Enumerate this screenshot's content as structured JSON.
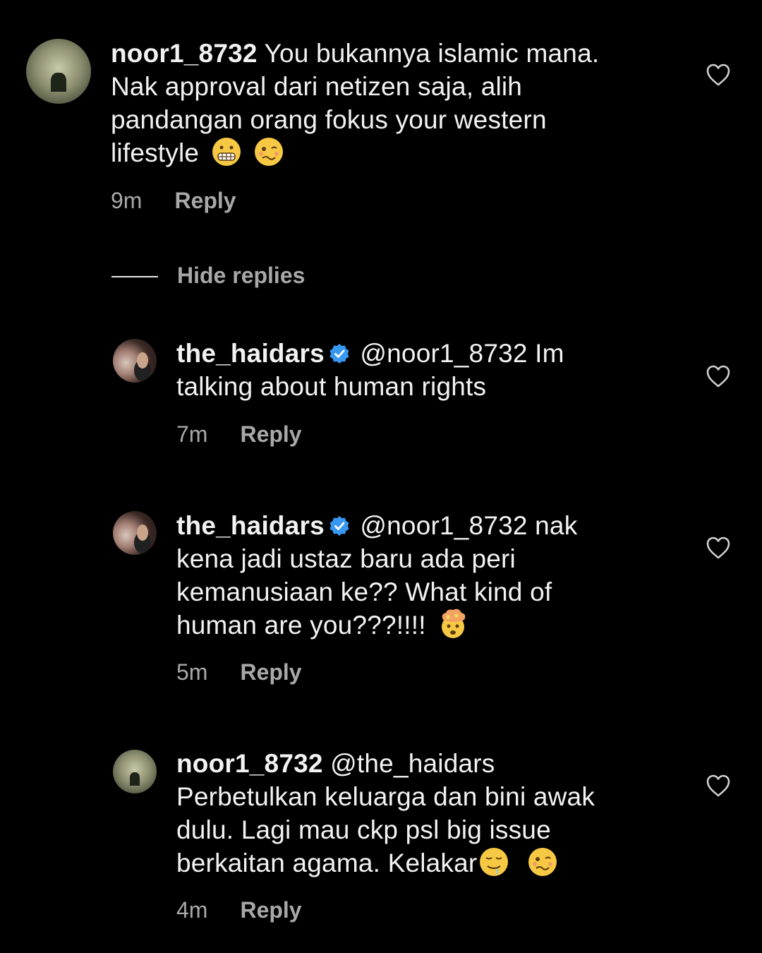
{
  "comments": [
    {
      "username": "noor1_8732",
      "verified": false,
      "mention": "",
      "lines": [
        "You bukannya islamic mana.",
        "Nak approval dari netizen saja, alih",
        "pandangan orang fokus your western",
        "lifestyle"
      ],
      "emojis": [
        "grimacing-face-emoji",
        "woozy-face-emoji"
      ],
      "time": "9m",
      "reply_label": "Reply"
    },
    {
      "username": "the_haidars",
      "verified": true,
      "mention": "@noor1_8732",
      "lines": [
        "Im",
        "talking about human rights"
      ],
      "emojis": [],
      "time": "7m",
      "reply_label": "Reply"
    },
    {
      "username": "the_haidars",
      "verified": true,
      "mention": "@noor1_8732",
      "lines": [
        "nak",
        "kena jadi ustaz baru ada peri",
        "kemanusiaan ke?? What kind of",
        "human are you???!!!!"
      ],
      "emojis": [
        "exploding-head-emoji"
      ],
      "time": "5m",
      "reply_label": "Reply"
    },
    {
      "username": "noor1_8732",
      "verified": false,
      "mention": "@the_haidars",
      "lines": [
        "",
        "Perbetulkan keluarga dan bini awak",
        "dulu. Lagi mau ckp psl big issue",
        "berkaitan agama. Kelakar"
      ],
      "emojis": [
        "drooling-face-emoji",
        "woozy-face-emoji"
      ],
      "time": "4m",
      "reply_label": "Reply"
    }
  ],
  "hide_replies_label": "Hide replies",
  "colors": {
    "background": "#000000",
    "text": "#f2f2f2",
    "muted": "#a8a8a8",
    "verified": "#3897f0"
  }
}
